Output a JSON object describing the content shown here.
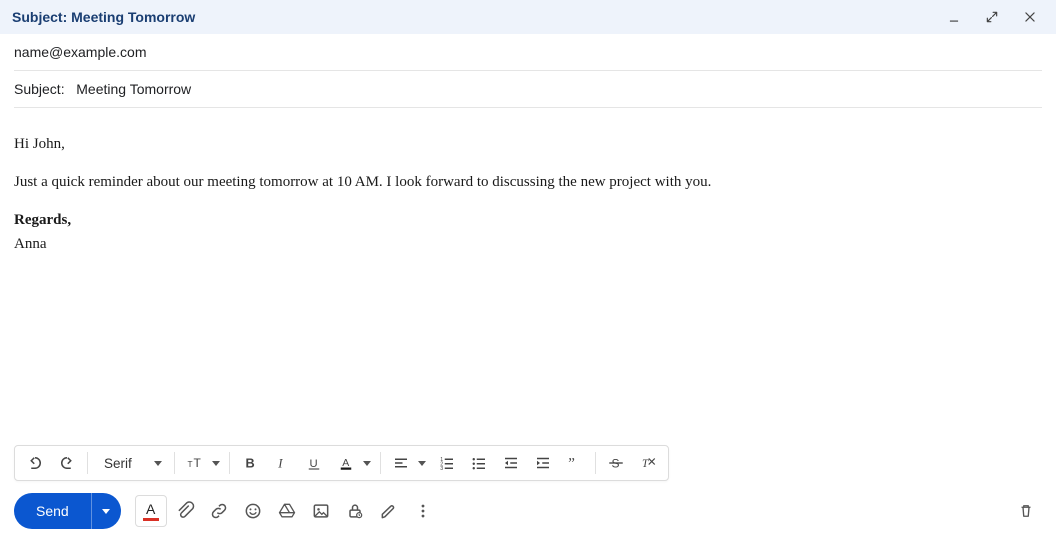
{
  "titlebar": {
    "prefix": "Subject:",
    "subject": "Meeting Tomorrow"
  },
  "headers": {
    "to": "name@example.com",
    "subject_label": "Subject:",
    "subject_value": "Meeting Tomorrow"
  },
  "body": {
    "greeting": "Hi John,",
    "paragraph": "Just a quick reminder about our meeting tomorrow at 10 AM. I look forward to discussing the new project with you.",
    "closing": "Regards,",
    "signature": "Anna"
  },
  "format_toolbar": {
    "font": "Serif"
  },
  "bottom": {
    "send_label": "Send"
  },
  "a11y": {
    "minimize": "Minimize",
    "restore": "Pop-out",
    "close": "Close",
    "undo": "Undo",
    "redo": "Redo",
    "font_size": "Font size",
    "bold": "Bold",
    "italic": "Italic",
    "underline": "Underline",
    "text_color": "Text color",
    "align": "Align",
    "numbered_list": "Numbered list",
    "bulleted_list": "Bulleted list",
    "indent_less": "Indent less",
    "indent_more": "Indent more",
    "quote": "Quote",
    "strikethrough": "Strikethrough",
    "remove_formatting": "Remove formatting",
    "attach": "Attach files",
    "link": "Insert link",
    "emoji": "Insert emoji",
    "drive": "Insert from Drive",
    "photo": "Insert photo",
    "confidential": "Confidential mode",
    "signature": "Insert signature",
    "more": "More options",
    "trash": "Discard draft",
    "send_more": "More send options"
  }
}
